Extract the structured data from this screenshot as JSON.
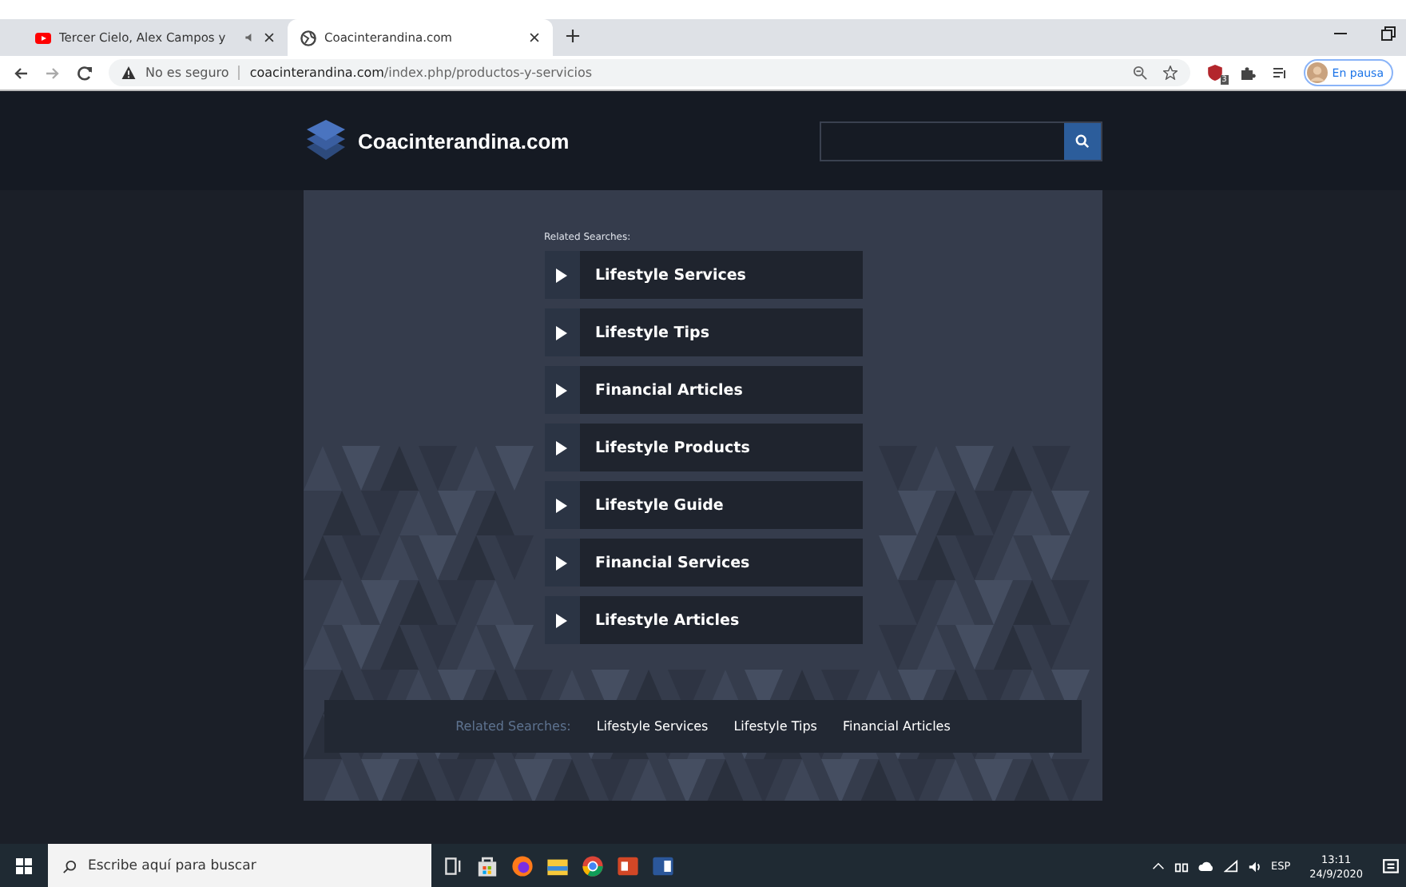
{
  "browser": {
    "tabs": [
      {
        "title": "Tercer Cielo, Alex Campos y",
        "selected": false,
        "kind": "video"
      },
      {
        "title": "Coacinterandina.com",
        "selected": true,
        "kind": "site"
      }
    ],
    "address": {
      "security": "No es seguro",
      "domain": "coacinterandina.com",
      "path": "/index.php/productos-y-servicios"
    },
    "profile": "En pausa",
    "extension_badge": "3"
  },
  "site": {
    "logo": "Coacinterandina.com",
    "related_label": "Related Searches:",
    "links": [
      "Lifestyle Services",
      "Lifestyle Tips",
      "Financial Articles",
      "Lifestyle Products",
      "Lifestyle Guide",
      "Financial Services",
      "Lifestyle Articles"
    ],
    "footer": {
      "label": "Related Searches:",
      "links": [
        "Lifestyle Services",
        "Lifestyle Tips",
        "Financial Articles"
      ]
    }
  },
  "taskbar": {
    "search_placeholder": "Escribe aquí para buscar",
    "language": "ESP",
    "time": "13:11",
    "date": "24/9/2020"
  }
}
